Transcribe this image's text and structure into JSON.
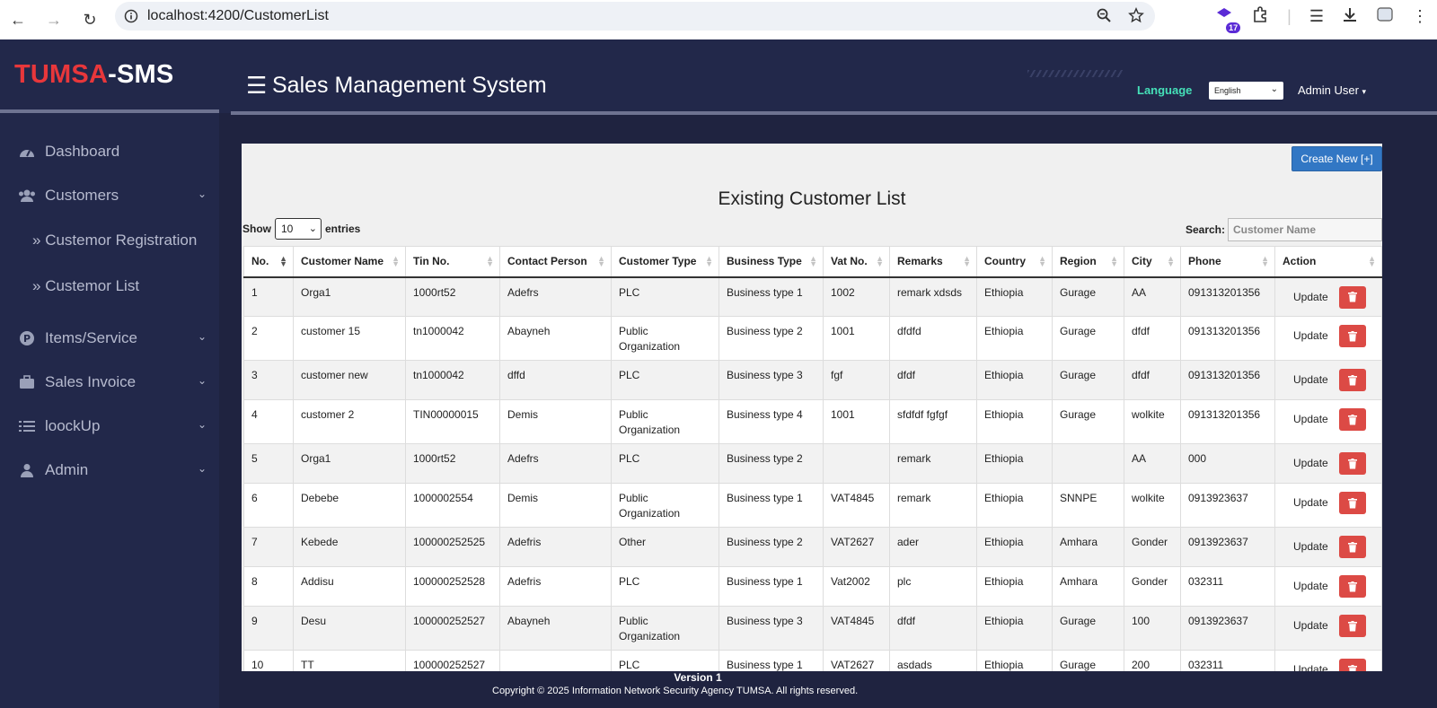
{
  "browser": {
    "url": "localhost:4200/CustomerList",
    "extension_badge": "17"
  },
  "brand": {
    "part1": "TUMSA",
    "part2": "-SMS"
  },
  "sidebar": {
    "items": [
      {
        "label": "Dashboard",
        "icon": "dashboard-icon"
      },
      {
        "label": "Customers",
        "icon": "users-icon"
      },
      {
        "label": "Items/Service",
        "icon": "p-circle-icon"
      },
      {
        "label": "Sales Invoice",
        "icon": "briefcase-icon"
      },
      {
        "label": "loockUp",
        "icon": "list-icon"
      },
      {
        "label": "Admin",
        "icon": "user-icon"
      }
    ],
    "subitems": [
      {
        "label": "Custemor Registration"
      },
      {
        "label": "Custemor List"
      }
    ]
  },
  "header": {
    "title": "Sales Management System",
    "language_label": "Language",
    "language_value": "English",
    "user": "Admin User"
  },
  "panel": {
    "create_button": "Create New [+]",
    "title": "Existing Customer List",
    "show_label": "Show",
    "entries_value": "10",
    "entries_label": "entries",
    "search_label": "Search:",
    "search_placeholder": "Customer Name"
  },
  "table": {
    "columns": [
      "No.",
      "Customer Name",
      "Tin No.",
      "Contact Person",
      "Customer Type",
      "Business Type",
      "Vat No.",
      "Remarks",
      "Country",
      "Region",
      "City",
      "Phone",
      "Action"
    ],
    "update_label": "Update",
    "rows": [
      {
        "no": "1",
        "name": "Orga1",
        "tin": "1000rt52",
        "contact": "Adefrs",
        "ctype": "PLC",
        "btype": "Business type 1",
        "vat": "1002",
        "remarks": "remark xdsds",
        "country": "Ethiopia",
        "region": "Gurage",
        "city": "AA",
        "phone": "091313201356"
      },
      {
        "no": "2",
        "name": "customer 15",
        "tin": "tn1000042",
        "contact": "Abayneh",
        "ctype": "Public Organization",
        "btype": "Business type 2",
        "vat": "1001",
        "remarks": "dfdfd",
        "country": "Ethiopia",
        "region": "Gurage",
        "city": "dfdf",
        "phone": "091313201356"
      },
      {
        "no": "3",
        "name": "customer new",
        "tin": "tn1000042",
        "contact": "dffd",
        "ctype": "PLC",
        "btype": "Business type 3",
        "vat": "fgf",
        "remarks": "dfdf",
        "country": "Ethiopia",
        "region": "Gurage",
        "city": "dfdf",
        "phone": "091313201356"
      },
      {
        "no": "4",
        "name": "customer 2",
        "tin": "TIN00000015",
        "contact": "Demis",
        "ctype": "Public Organization",
        "btype": "Business type 4",
        "vat": "1001",
        "remarks": "sfdfdf fgfgf",
        "country": "Ethiopia",
        "region": "Gurage",
        "city": "wolkite",
        "phone": "091313201356"
      },
      {
        "no": "5",
        "name": "Orga1",
        "tin": "1000rt52",
        "contact": "Adefrs",
        "ctype": "PLC",
        "btype": "Business type 2",
        "vat": "",
        "remarks": "remark",
        "country": "Ethiopia",
        "region": "",
        "city": "AA",
        "phone": "000"
      },
      {
        "no": "6",
        "name": "Debebe",
        "tin": "1000002554",
        "contact": "Demis",
        "ctype": "Public Organization",
        "btype": "Business type 1",
        "vat": "VAT4845",
        "remarks": "remark",
        "country": "Ethiopia",
        "region": "SNNPE",
        "city": "wolkite",
        "phone": "0913923637"
      },
      {
        "no": "7",
        "name": "Kebede",
        "tin": "100000252525",
        "contact": "Adefris",
        "ctype": "Other",
        "btype": "Business type 2",
        "vat": "VAT2627",
        "remarks": "ader",
        "country": "Ethiopia",
        "region": "Amhara",
        "city": "Gonder",
        "phone": "0913923637"
      },
      {
        "no": "8",
        "name": "Addisu",
        "tin": "100000252528",
        "contact": "Adefris",
        "ctype": "PLC",
        "btype": "Business type 1",
        "vat": "Vat2002",
        "remarks": "plc",
        "country": "Ethiopia",
        "region": "Amhara",
        "city": "Gonder",
        "phone": "032311"
      },
      {
        "no": "9",
        "name": "Desu",
        "tin": "100000252527",
        "contact": "Abayneh",
        "ctype": "Public Organization",
        "btype": "Business type 3",
        "vat": "VAT4845",
        "remarks": "dfdf",
        "country": "Ethiopia",
        "region": "Gurage",
        "city": "100",
        "phone": "0913923637"
      },
      {
        "no": "10",
        "name": "TT",
        "tin": "100000252527",
        "contact": "",
        "ctype": "PLC",
        "btype": "Business type 1",
        "vat": "VAT2627",
        "remarks": "asdads",
        "country": "Ethiopia",
        "region": "Gurage",
        "city": "200",
        "phone": "032311"
      }
    ]
  },
  "footer": {
    "version": "Version 1",
    "copyright": "Copyright © 2025 Information Network Security Agency TUMSA. All rights reserved."
  },
  "colors": {
    "sidebar_bg": "#22284a",
    "brand_accent": "#e8373b",
    "language_accent": "#45e0b8",
    "create_button": "#3277c4",
    "delete_button": "#dc4a45"
  }
}
